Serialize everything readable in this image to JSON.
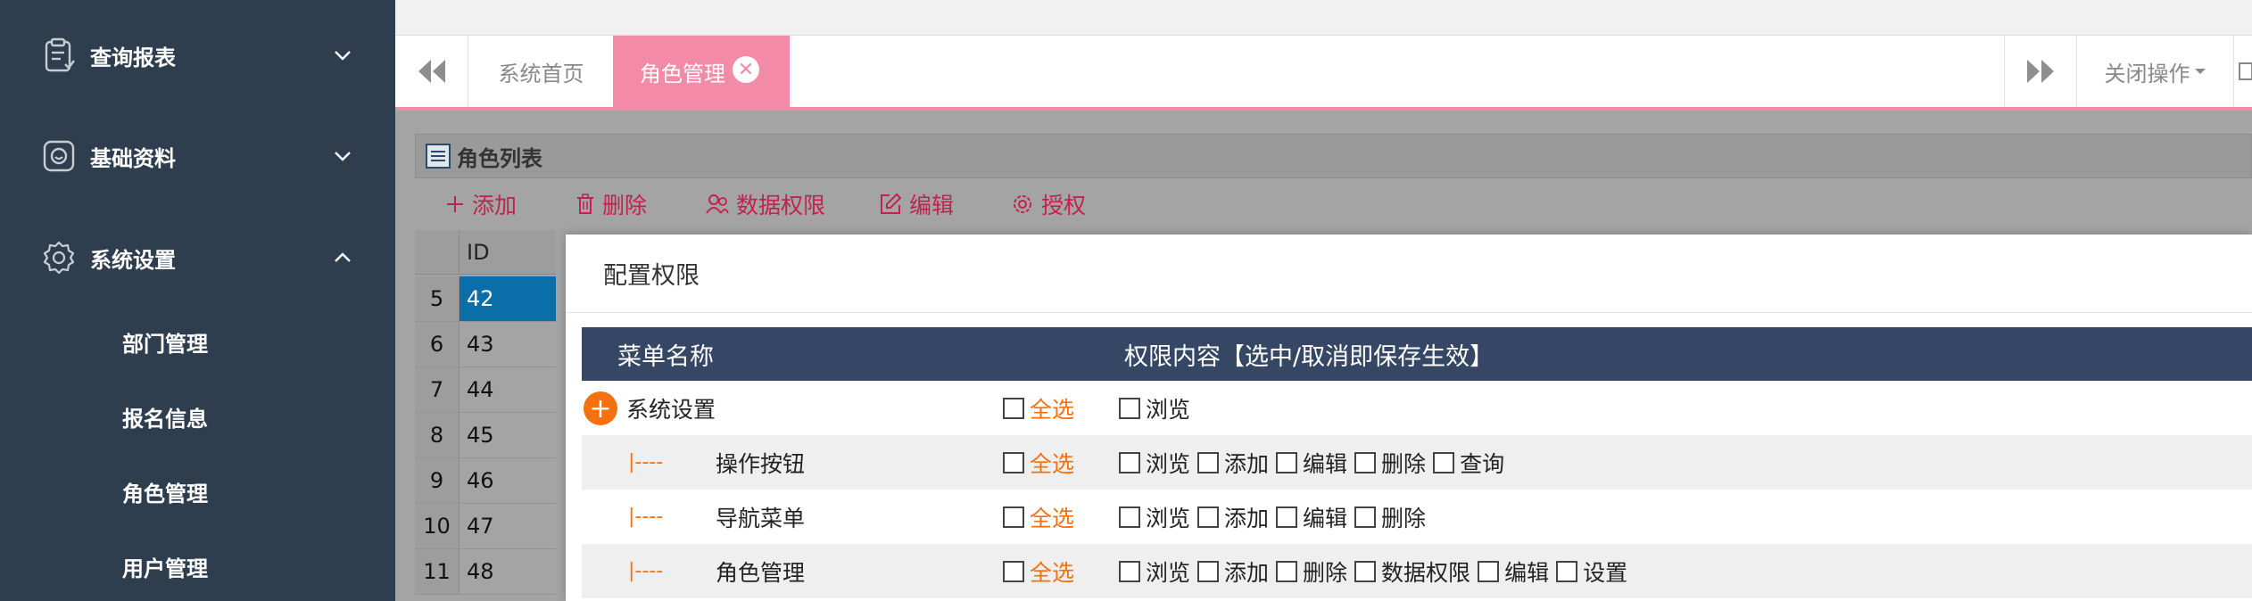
{
  "sidebar": {
    "groups": [
      {
        "label": "查询报表",
        "icon": "report-icon",
        "expanded": false
      },
      {
        "label": "基础资料",
        "icon": "basic-data-icon",
        "expanded": false
      },
      {
        "label": "系统设置",
        "icon": "settings-gear-icon",
        "expanded": true
      }
    ],
    "sub_items": [
      {
        "label": "部门管理"
      },
      {
        "label": "报名信息"
      },
      {
        "label": "角色管理"
      },
      {
        "label": "用户管理"
      }
    ]
  },
  "tabs": {
    "items": [
      {
        "label": "系统首页",
        "active": false
      },
      {
        "label": "角色管理",
        "active": true
      }
    ],
    "close_ops_label": "关闭操作"
  },
  "panel": {
    "title": "角色列表",
    "toolbar": [
      {
        "label": "添加",
        "icon": "plus-icon"
      },
      {
        "label": "删除",
        "icon": "trash-icon"
      },
      {
        "label": "数据权限",
        "icon": "users-icon"
      },
      {
        "label": "编辑",
        "icon": "edit-icon"
      },
      {
        "label": "授权",
        "icon": "gear-icon"
      }
    ],
    "grid": {
      "column_header": "ID",
      "rows": [
        {
          "num": "5",
          "id": "42",
          "selected": true
        },
        {
          "num": "6",
          "id": "43",
          "selected": false
        },
        {
          "num": "7",
          "id": "44",
          "selected": false
        },
        {
          "num": "8",
          "id": "45",
          "selected": false
        },
        {
          "num": "9",
          "id": "46",
          "selected": false
        },
        {
          "num": "10",
          "id": "47",
          "selected": false
        },
        {
          "num": "11",
          "id": "48",
          "selected": false
        }
      ]
    }
  },
  "dialog": {
    "title": "配置权限",
    "table": {
      "header_name": "菜单名称",
      "header_perms": "权限内容【选中/取消即保存生效】",
      "select_all_label": "全选",
      "child_prefix": "|----",
      "rows": [
        {
          "name": "系统设置",
          "is_parent": true,
          "perms": [
            "浏览"
          ]
        },
        {
          "name": "操作按钮",
          "is_parent": false,
          "perms": [
            "浏览",
            "添加",
            "编辑",
            "删除",
            "查询"
          ]
        },
        {
          "name": "导航菜单",
          "is_parent": false,
          "perms": [
            "浏览",
            "添加",
            "编辑",
            "删除"
          ]
        },
        {
          "name": "角色管理",
          "is_parent": false,
          "perms": [
            "浏览",
            "添加",
            "删除",
            "数据权限",
            "编辑",
            "设置"
          ]
        }
      ]
    }
  },
  "colors": {
    "sidebar_bg": "#2f3e4e",
    "accent_pink": "#f38aa8",
    "toolbar_red": "#c1224f",
    "select_all_orange": "#f5700f",
    "table_header_navy": "#354764",
    "selected_row_blue": "#0a6fa8"
  }
}
